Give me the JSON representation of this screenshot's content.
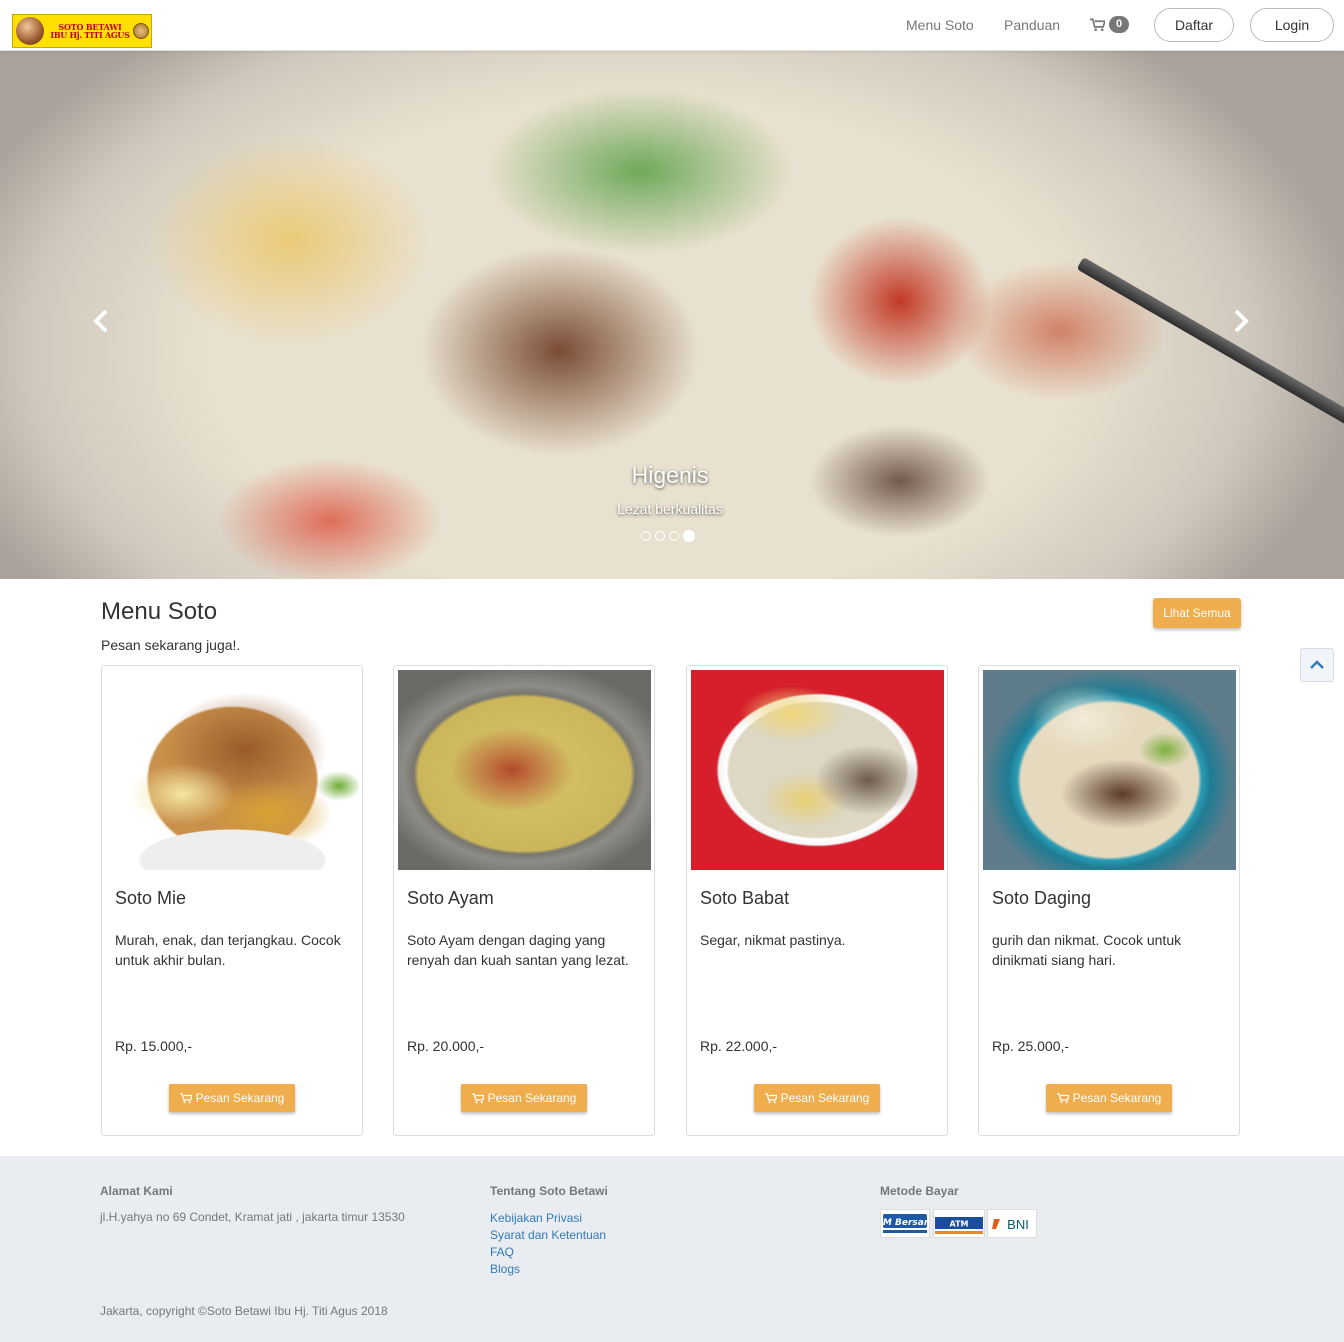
{
  "logo": {
    "line1": "SOTO BETAWI",
    "line2": "IBU Hj. TITI AGUS"
  },
  "nav": {
    "menu": "Menu Soto",
    "guide": "Panduan",
    "cart_count": "0",
    "register": "Daftar",
    "login": "Login"
  },
  "hero": {
    "title": "Higenis",
    "subtitle": "Lezat berkualitas",
    "slides": 4,
    "active_slide": 4
  },
  "menu": {
    "title": "Menu Soto",
    "subtitle": "Pesan sekarang juga!.",
    "see_all": "Lihat Semua",
    "order_label": "Pesan Sekarang",
    "items": [
      {
        "name": "Soto Mie",
        "desc": "Murah, enak, dan terjangkau. Cocok untuk akhir bulan.",
        "price": "Rp. 15.000,-"
      },
      {
        "name": "Soto Ayam",
        "desc": "Soto Ayam dengan daging yang renyah dan kuah santan yang lezat.",
        "price": "Rp. 20.000,-"
      },
      {
        "name": "Soto Babat",
        "desc": "Segar, nikmat pastinya.",
        "price": "Rp. 22.000,-"
      },
      {
        "name": "Soto Daging",
        "desc": "gurih dan nikmat. Cocok untuk dinikmati siang hari.",
        "price": "Rp. 25.000,-"
      }
    ]
  },
  "footer": {
    "address_title": "Alamat Kami",
    "address": "jl.H.yahya no 69 Condet, Kramat jati , jakarta timur 13530",
    "about_title": "Tentang Soto Betawi",
    "about_links": [
      "Kebijakan Privasi",
      "Syarat dan Ketentuan",
      "FAQ",
      "Blogs"
    ],
    "payment_title": "Metode Bayar",
    "payments": [
      "ATM Bersama",
      "ATM",
      "BNI"
    ],
    "copyright": "Jakarta, copyright ©Soto Betawi Ibu Hj. Titi Agus 2018"
  },
  "colors": {
    "accent": "#f0ad4e",
    "link": "#337ab7",
    "footer_bg": "#e9edf1"
  }
}
